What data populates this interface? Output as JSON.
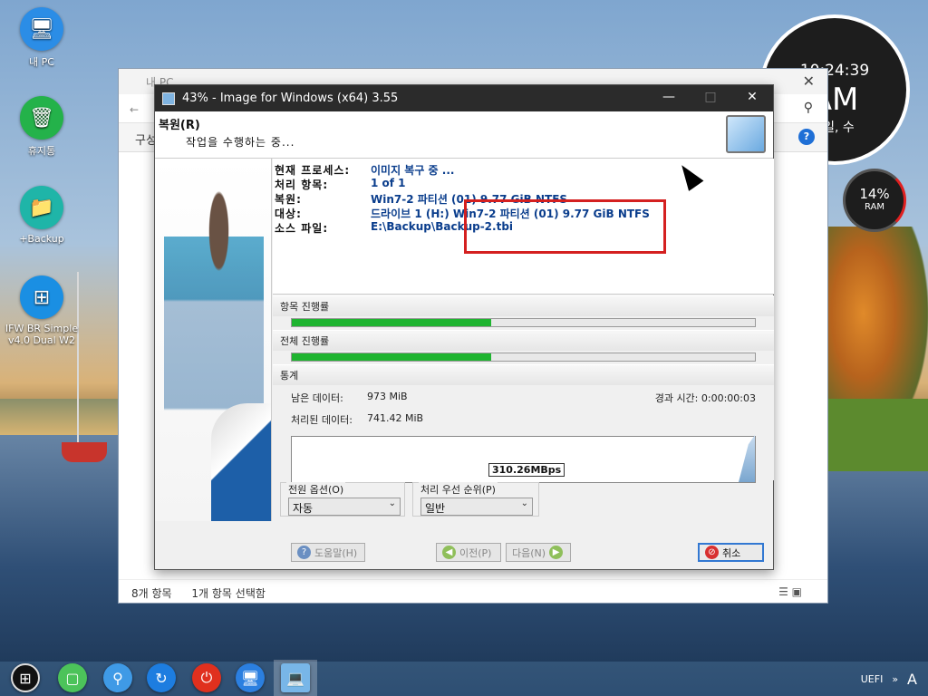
{
  "desktop": {
    "icons": [
      {
        "label": "내 PC",
        "icon": "monitor-icon"
      },
      {
        "label": "휴지통",
        "icon": "trash-icon"
      },
      {
        "label": "+Backup",
        "icon": "folder-add-icon"
      },
      {
        "label_line1": "IFW BR Simple",
        "label_line2": "v4.0 Dual W2",
        "icon": "windows-logo-icon"
      }
    ]
  },
  "clock": {
    "time": "10:24:39",
    "ampm": "AM",
    "date": "3일, 수"
  },
  "ram": {
    "percent": "14%",
    "label": "RAM",
    "value": 0.14
  },
  "explorer": {
    "title": "내 PC",
    "ribbon_label": "구성",
    "status_items": "8개 항목",
    "status_selected": "1개 항목 선택함"
  },
  "dialog": {
    "title": "43% - Image for Windows (x64) 3.55",
    "header_title": "복원(R)",
    "header_subtitle": "작업을 수행하는 중...",
    "info": {
      "process_label": "현재 프로세스:",
      "process_value": "이미지 복구 중 ...",
      "items_label": "처리 항목:",
      "items_value": "1 of 1",
      "restore_label": "복원:",
      "restore_value": "Win7-2 파티션 (01) 9.77 GiB NTFS",
      "target_label": "대상:",
      "target_value": "드라이브 1 (H:) Win7-2 파티션 (01) 9.77 GiB NTFS",
      "source_label": "소스 파일:",
      "source_value": "E:\\Backup\\Backup-2.tbi"
    },
    "item_progress": {
      "label": "항목 진행률",
      "value": 0.43
    },
    "total_progress": {
      "label": "전체 진행률",
      "value": 0.43
    },
    "stats": {
      "label": "통계",
      "remaining_label": "남은 데이터:",
      "remaining_value": "973 MiB",
      "processed_label": "처리된 데이터:",
      "processed_value": "741.42 MiB",
      "elapsed_label": "경과 시간:",
      "elapsed_value": "0:00:00:03",
      "speed": "310.26MBps"
    },
    "power": {
      "label": "전원 옵션(O)",
      "value": "자동"
    },
    "priority": {
      "label": "처리 우선 순위(P)",
      "value": "일반"
    },
    "buttons": {
      "help": "도움말(H)",
      "prev": "이전(P)",
      "next": "다음(N)",
      "cancel": "취소"
    }
  },
  "tray": {
    "uefi": "UEFI",
    "chevron": "»",
    "ime": "A"
  },
  "colors": {
    "progress": "#1fb430",
    "accent": "#3278d2",
    "highlight_box": "#d42020"
  }
}
